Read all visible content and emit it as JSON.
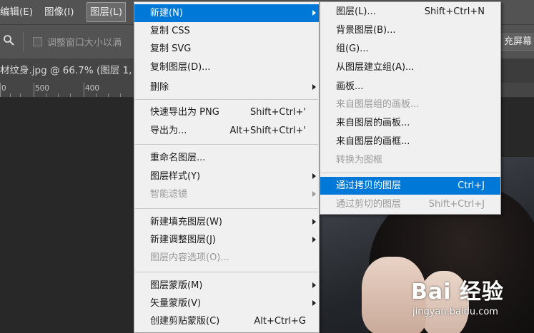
{
  "menubar": {
    "items": [
      "编辑(E)",
      "图像(I)",
      "图层(L)"
    ]
  },
  "options_bar": {
    "checkbox_label": "调整窗口大小以满",
    "right_button": "充屏幕"
  },
  "document_tab": {
    "title": "材纹身.jpg @ 66.7% (图层 1,"
  },
  "ruler": {
    "labels": [
      "0",
      "500",
      "400"
    ]
  },
  "layer_menu": {
    "items": [
      {
        "label": "新建(N)",
        "shortcut": "",
        "submenu": true,
        "disabled": false,
        "highlighted": true
      },
      {
        "label": "复制 CSS",
        "shortcut": "",
        "submenu": false,
        "disabled": false
      },
      {
        "label": "复制 SVG",
        "shortcut": "",
        "submenu": false,
        "disabled": false
      },
      {
        "label": "复制图层(D)...",
        "shortcut": "",
        "submenu": false,
        "disabled": false
      },
      {
        "label": "删除",
        "shortcut": "",
        "submenu": true,
        "disabled": false
      },
      {
        "label": "快速导出为 PNG",
        "shortcut": "Shift+Ctrl+'",
        "submenu": false,
        "disabled": false
      },
      {
        "label": "导出为...",
        "shortcut": "Alt+Shift+Ctrl+'",
        "submenu": false,
        "disabled": false
      },
      {
        "label": "重命名图层...",
        "shortcut": "",
        "submenu": false,
        "disabled": false
      },
      {
        "label": "图层样式(Y)",
        "shortcut": "",
        "submenu": true,
        "disabled": false
      },
      {
        "label": "智能滤镜",
        "shortcut": "",
        "submenu": true,
        "disabled": true
      },
      {
        "label": "新建填充图层(W)",
        "shortcut": "",
        "submenu": true,
        "disabled": false
      },
      {
        "label": "新建调整图层(J)",
        "shortcut": "",
        "submenu": true,
        "disabled": false
      },
      {
        "label": "图层内容选项(O)...",
        "shortcut": "",
        "submenu": false,
        "disabled": true
      },
      {
        "label": "图层蒙版(M)",
        "shortcut": "",
        "submenu": true,
        "disabled": false
      },
      {
        "label": "矢量蒙版(V)",
        "shortcut": "",
        "submenu": true,
        "disabled": false
      },
      {
        "label": "创建剪贴蒙版(C)",
        "shortcut": "Alt+Ctrl+G",
        "submenu": false,
        "disabled": false
      }
    ]
  },
  "new_submenu": {
    "items": [
      {
        "label": "图层(L)...",
        "shortcut": "Shift+Ctrl+N",
        "disabled": false,
        "highlighted": false
      },
      {
        "label": "背景图层(B)...",
        "shortcut": "",
        "disabled": false,
        "highlighted": false
      },
      {
        "label": "组(G)...",
        "shortcut": "",
        "disabled": false,
        "highlighted": false
      },
      {
        "label": "从图层建立组(A)...",
        "shortcut": "",
        "disabled": false,
        "highlighted": false
      },
      {
        "label": "画板...",
        "shortcut": "",
        "disabled": false,
        "highlighted": false
      },
      {
        "label": "来自图层组的画板...",
        "shortcut": "",
        "disabled": true,
        "highlighted": false
      },
      {
        "label": "来自图层的画板...",
        "shortcut": "",
        "disabled": false,
        "highlighted": false
      },
      {
        "label": "来自图层的画框...",
        "shortcut": "",
        "disabled": false,
        "highlighted": false
      },
      {
        "label": "转换为图框",
        "shortcut": "",
        "disabled": true,
        "highlighted": false
      },
      {
        "label": "通过拷贝的图层",
        "shortcut": "Ctrl+J",
        "disabled": false,
        "highlighted": true
      },
      {
        "label": "通过剪切的图层",
        "shortcut": "Shift+Ctrl+J",
        "disabled": true,
        "highlighted": false
      }
    ]
  },
  "watermark": {
    "main": "Bai 经验",
    "sub": "jingyan.baidu.com"
  },
  "colors": {
    "highlight": "#0078d7",
    "menu_bg": "#f0f0f0",
    "chrome": "#535353"
  }
}
